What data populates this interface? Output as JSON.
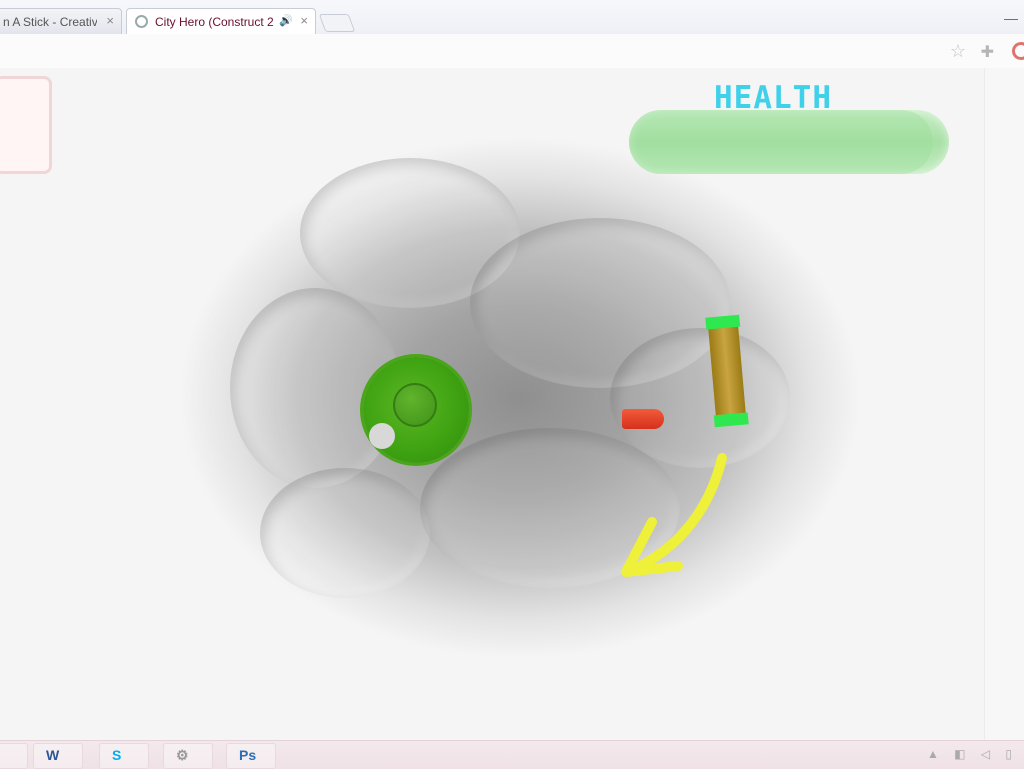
{
  "browser": {
    "tabs": [
      {
        "label": "n A Stick - Creativ",
        "close": "×"
      },
      {
        "label": "City Hero (Construct 2",
        "close": "×",
        "audio": "🔊"
      }
    ],
    "window_min": "—",
    "star_icon": "☆",
    "extension_icon": "✚"
  },
  "game": {
    "health": {
      "label": "HEALTH",
      "level_fraction": 0.95
    },
    "colors": {
      "health_text": "#3fd1ea",
      "health_bar": "#a8e0a6",
      "hero": "#3fa312",
      "enemy": "#e23a22",
      "barrier_caps": "#2fe84f",
      "arrow": "#eef03a"
    }
  },
  "taskbar": {
    "items": [
      {
        "label": "",
        "icon": "chrome-icon"
      },
      {
        "label": "W",
        "icon": "word-icon"
      },
      {
        "label": "S",
        "icon": "skype-icon"
      },
      {
        "label": "⚙",
        "icon": "settings-icon"
      },
      {
        "label": "Ps",
        "icon": "photoshop-icon"
      }
    ],
    "tray": "▲ ◧ ◁ ▯"
  }
}
